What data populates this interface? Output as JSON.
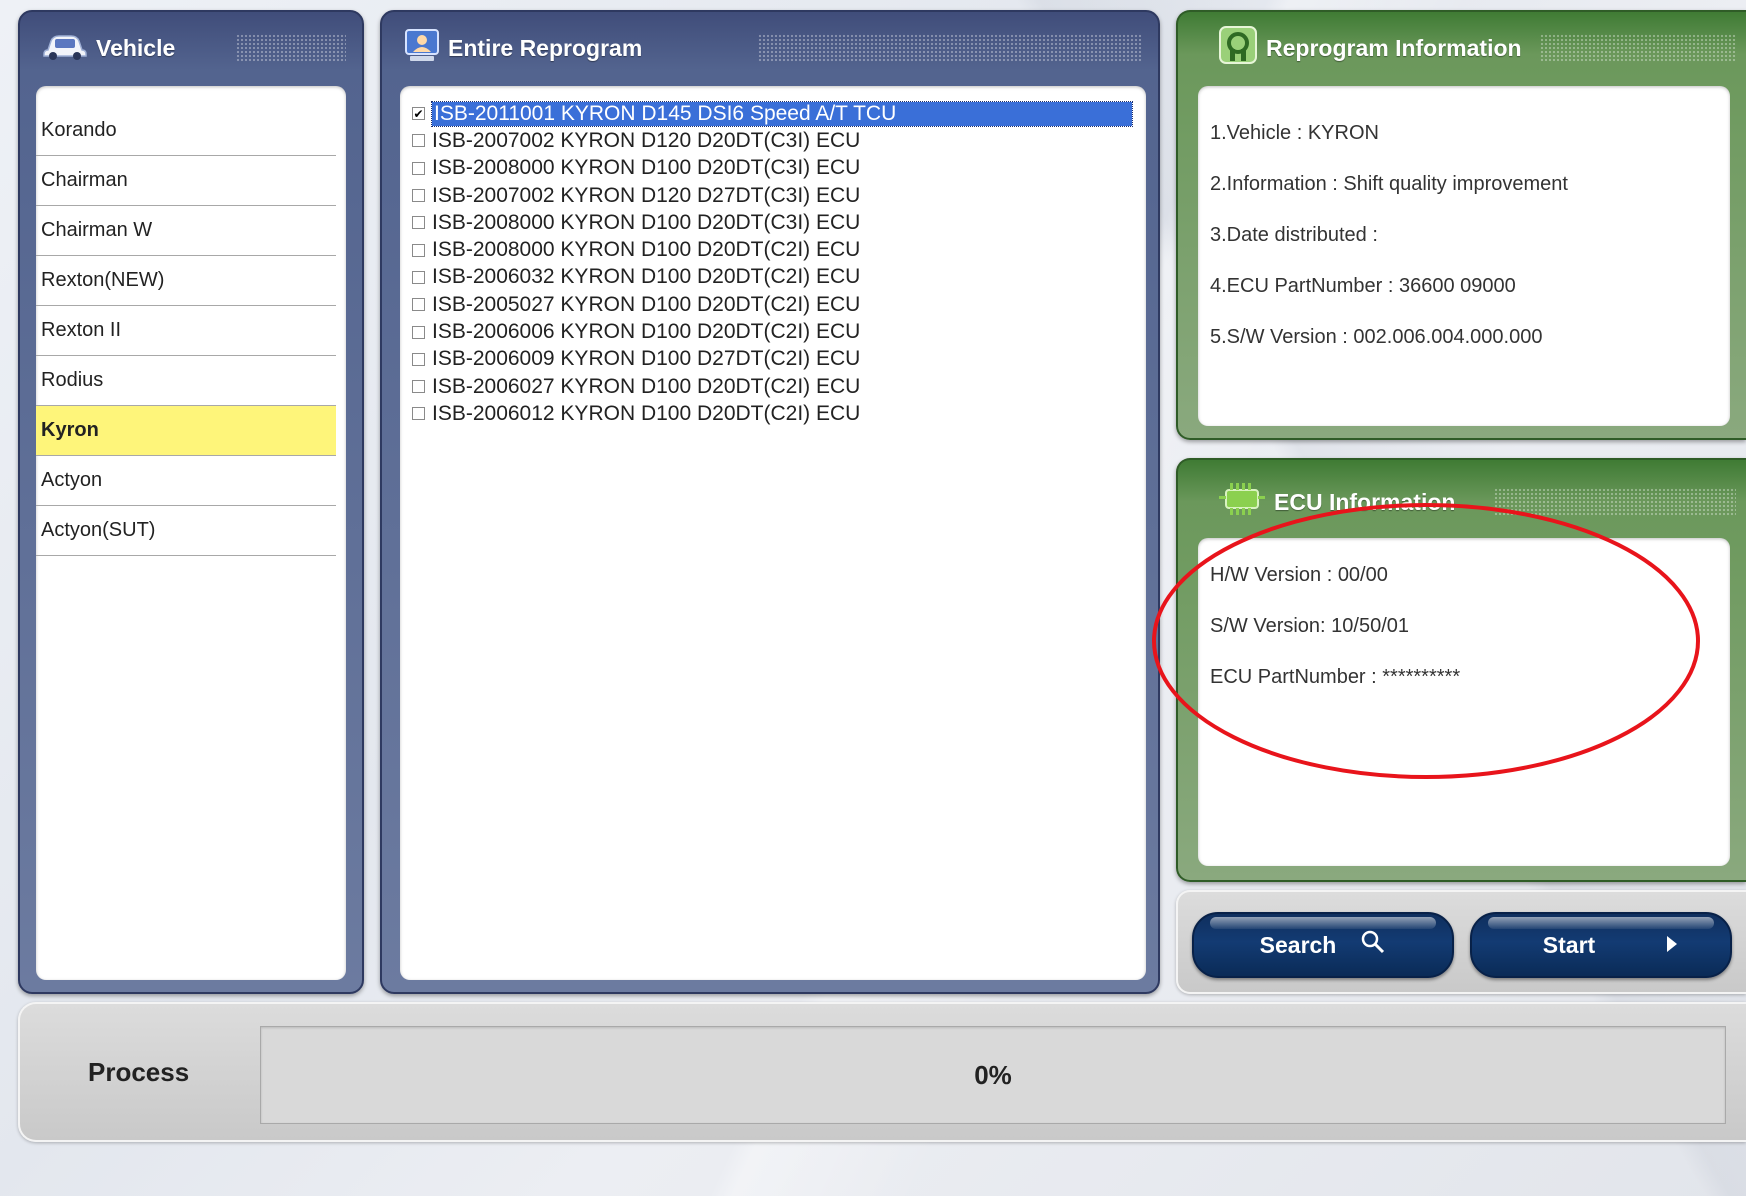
{
  "vehicle_panel": {
    "title": "Vehicle",
    "items": [
      "Korando",
      "Chairman",
      "Chairman W",
      "Rexton(NEW)",
      "Rexton II",
      "Rodius",
      "Kyron",
      "Actyon",
      "Actyon(SUT)"
    ],
    "selected": "Kyron"
  },
  "program_panel": {
    "title": "Entire Reprogram",
    "items": [
      {
        "label": "ISB-2011001 KYRON D145 DSI6 Speed A/T TCU",
        "checked": true,
        "selected": true
      },
      {
        "label": "ISB-2007002 KYRON D120 D20DT(C3I) ECU",
        "checked": false
      },
      {
        "label": "ISB-2008000 KYRON D100 D20DT(C3I) ECU",
        "checked": false
      },
      {
        "label": "ISB-2007002 KYRON D120 D27DT(C3I) ECU",
        "checked": false
      },
      {
        "label": "ISB-2008000 KYRON D100 D20DT(C3I) ECU",
        "checked": false
      },
      {
        "label": "ISB-2008000 KYRON D100 D20DT(C2I) ECU",
        "checked": false
      },
      {
        "label": "ISB-2006032 KYRON D100 D20DT(C2I) ECU",
        "checked": false
      },
      {
        "label": "ISB-2005027 KYRON D100 D20DT(C2I) ECU",
        "checked": false
      },
      {
        "label": "ISB-2006006 KYRON D100 D20DT(C2I) ECU",
        "checked": false
      },
      {
        "label": "ISB-2006009 KYRON D100 D27DT(C2I) ECU",
        "checked": false
      },
      {
        "label": "ISB-2006027 KYRON D100 D20DT(C2I) ECU",
        "checked": false
      },
      {
        "label": "ISB-2006012 KYRON D100 D20DT(C2I) ECU",
        "checked": false
      }
    ]
  },
  "reprogram_info": {
    "title": "Reprogram Information",
    "lines": [
      "1.Vehicle : KYRON",
      "2.Information : Shift quality improvement",
      "3.Date distributed :",
      "4.ECU PartNumber : 36600 09000",
      "5.S/W Version : 002.006.004.000.000"
    ]
  },
  "ecu_info": {
    "title": "ECU Information",
    "lines": [
      "H/W Version : 00/00",
      "S/W Version: 10/50/01",
      "ECU PartNumber : **********"
    ],
    "highlight_color": "#e8141b"
  },
  "buttons": {
    "search": "Search",
    "start": "Start"
  },
  "process": {
    "label": "Process",
    "percent_text": "0%",
    "progress": 0
  },
  "colors": {
    "vehicle_selected": "#fef57a",
    "list_selected": "#3a6fd8",
    "blue_panel": "#53648f",
    "green_panel": "#6b985b",
    "button": "#133b73"
  }
}
